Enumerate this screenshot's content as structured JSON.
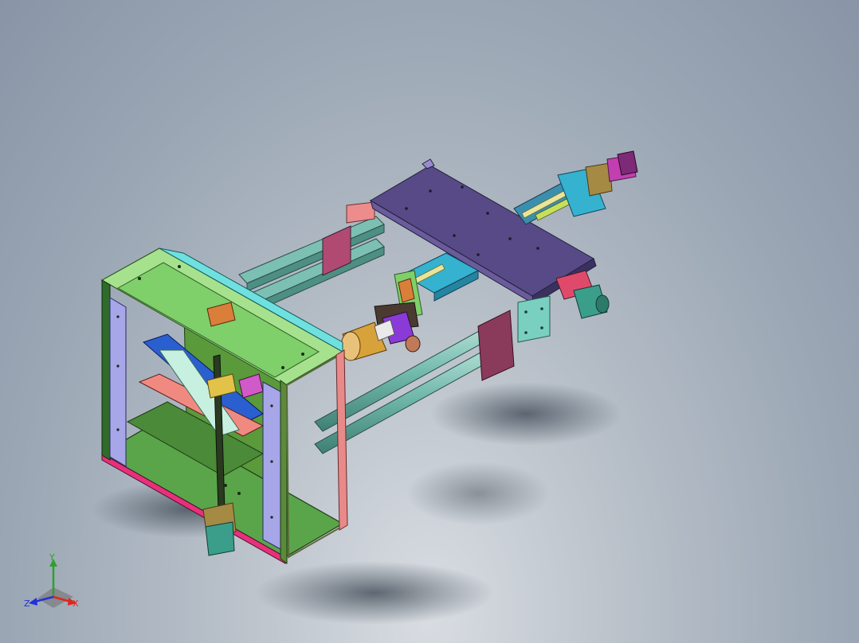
{
  "view": {
    "background_top": "#8995a6",
    "background_bottom": "#d9dde2"
  },
  "triad": {
    "x_label": "X",
    "y_label": "Y",
    "z_label": "Z",
    "x_color": "#e0261f",
    "y_color": "#2ea12e",
    "z_color": "#2332d6"
  },
  "palette": {
    "frame_green": "#7fcf6a",
    "frame_dark_green": "#2f6b2a",
    "frame_purple": "#9a9ad6",
    "frame_pink": "#e85a8c",
    "rail_teal": "#6bbbb0",
    "carriage_purple": "#574a86",
    "module_cyan": "#35b2cf",
    "motor_teal": "#3a9e8a",
    "motor_magenta": "#c23fb0",
    "beam_blue": "#2a5fd0",
    "spindle_gold": "#d8a23a"
  },
  "model": {
    "name_icon": "cnc-gantry-assembly-model"
  }
}
